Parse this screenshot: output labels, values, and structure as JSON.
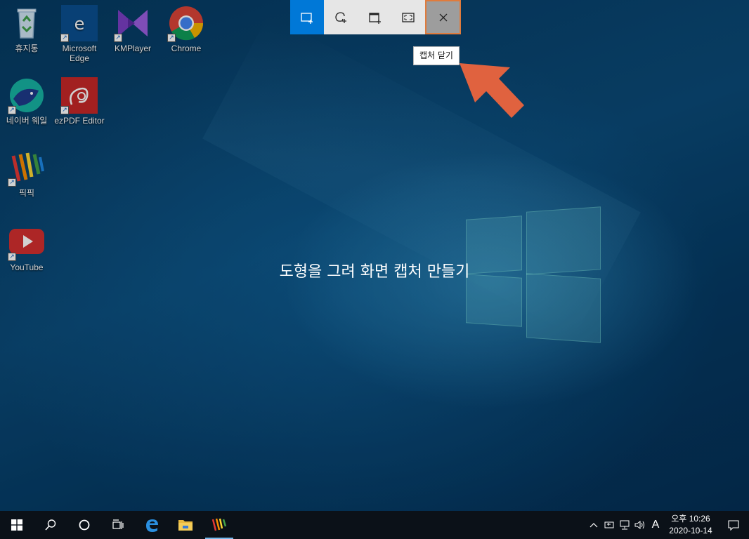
{
  "desktop": {
    "icons": [
      {
        "label": "휴지통",
        "icon": "recycle-bin-icon"
      },
      {
        "label": "Microsoft Edge",
        "icon": "edge-icon",
        "glyph_letter": "e"
      },
      {
        "label": "KMPlayer",
        "icon": "kmplayer-icon"
      },
      {
        "label": "Chrome",
        "icon": "chrome-icon"
      },
      {
        "label": "네이버 웨일",
        "icon": "naver-whale-icon"
      },
      {
        "label": "ezPDF Editor",
        "icon": "ezpdf-icon"
      },
      {
        "label": "픽픽",
        "icon": "picpick-icon"
      },
      {
        "label": "YouTube",
        "icon": "youtube-icon"
      }
    ],
    "shortcut_glyph": "↗"
  },
  "snip_toolbar": {
    "buttons": [
      {
        "name": "rectangular-snip",
        "icon": "rectangle-snip-icon",
        "active": true
      },
      {
        "name": "freeform-snip",
        "icon": "freeform-snip-icon",
        "active": false
      },
      {
        "name": "window-snip",
        "icon": "window-snip-icon",
        "active": false
      },
      {
        "name": "fullscreen-snip",
        "icon": "fullscreen-snip-icon",
        "active": false
      },
      {
        "name": "close-snip",
        "icon": "close-icon",
        "active": false,
        "hovered": true
      }
    ],
    "tooltip": "캡처 닫기"
  },
  "instruction": "도형을 그려 화면 캡처 만들기",
  "annotation": {
    "icon": "arrow-pointer-icon",
    "color": "#e0623f"
  },
  "taskbar": {
    "items": [
      "start-icon",
      "search-icon",
      "cortana-icon",
      "task-view-icon",
      "edge-icon",
      "file-explorer-icon",
      "picpick-icon"
    ],
    "tray": {
      "ime_label": "A",
      "time_period": "오후",
      "time": "10:26",
      "date": "2020-10-14"
    }
  },
  "colors": {
    "accent": "#0078d7",
    "close_hover": "#9d9d9d",
    "highlight_border": "#e07b3c"
  }
}
